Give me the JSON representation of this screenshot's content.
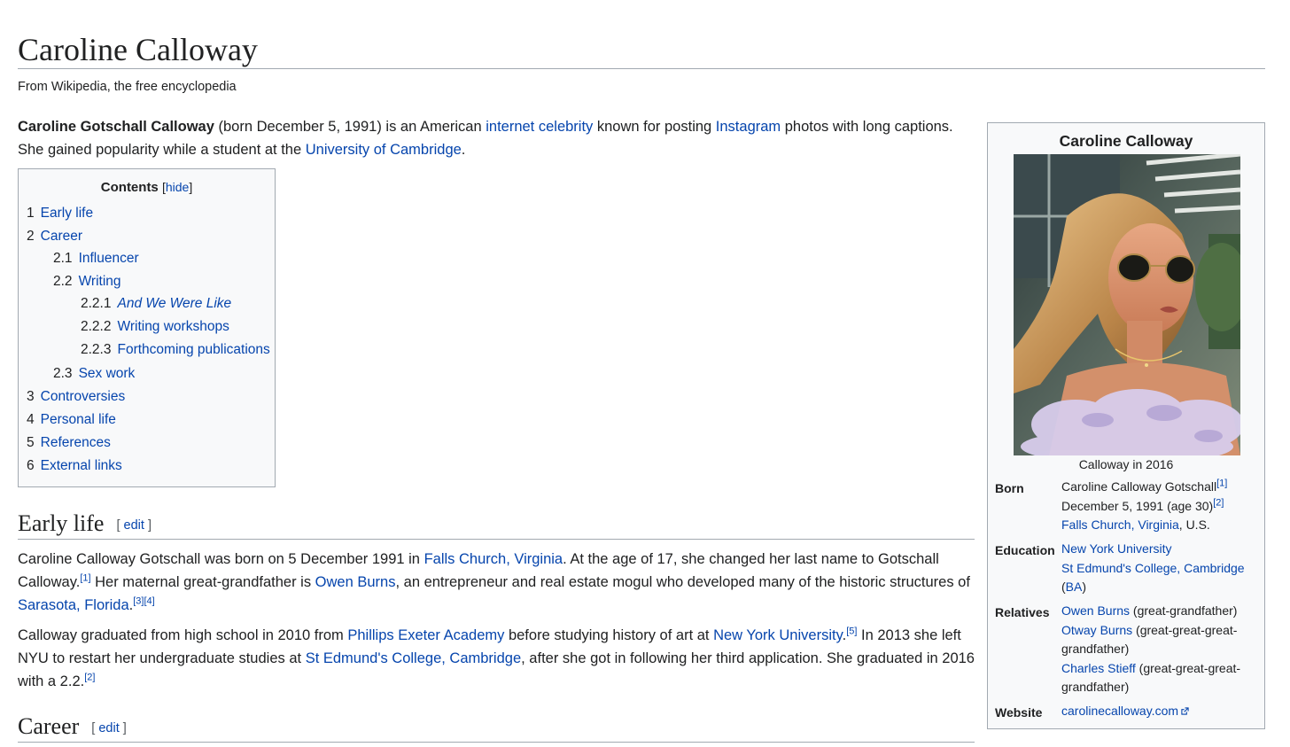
{
  "page": {
    "title": "Caroline Calloway",
    "tagline": "From Wikipedia, the free encyclopedia"
  },
  "lead": {
    "bold_name": "Caroline Gotschall Calloway",
    "t1": " (born December 5, 1991) is an American ",
    "link1": "internet celebrity",
    "t2": " known for posting ",
    "link2": "Instagram",
    "t3": " photos with long captions. She gained popularity while a student at the ",
    "link3": "University of Cambridge",
    "t4": "."
  },
  "toc": {
    "heading": "Contents",
    "bracket_open": "[",
    "hide": "hide",
    "bracket_close": "]",
    "items": [
      {
        "num": "1",
        "label": "Early life"
      },
      {
        "num": "2",
        "label": "Career"
      },
      {
        "num": "2.1",
        "label": "Influencer"
      },
      {
        "num": "2.2",
        "label": "Writing"
      },
      {
        "num": "2.2.1",
        "label": "And We Were Like"
      },
      {
        "num": "2.2.2",
        "label": "Writing workshops"
      },
      {
        "num": "2.2.3",
        "label": "Forthcoming publications"
      },
      {
        "num": "2.3",
        "label": "Sex work"
      },
      {
        "num": "3",
        "label": "Controversies"
      },
      {
        "num": "4",
        "label": "Personal life"
      },
      {
        "num": "5",
        "label": "References"
      },
      {
        "num": "6",
        "label": "External links"
      }
    ]
  },
  "early_life": {
    "heading": "Early life",
    "edit_open": "[",
    "edit": "edit",
    "edit_close": "]",
    "p1": {
      "t1": "Caroline Calloway Gotschall was born on 5 December 1991 in ",
      "link1": "Falls Church, Virginia",
      "t2": ". At the age of 17, she changed her last name to Gotschall Calloway.",
      "ref1": "[1]",
      "t3": " Her maternal great-grandfather is ",
      "link2": "Owen Burns",
      "t4": ", an entrepreneur and real estate mogul who developed many of the historic structures of ",
      "link3": "Sarasota, Florida",
      "t5": ".",
      "ref2": "[3]",
      "ref3": "[4]"
    },
    "p2": {
      "t1": "Calloway graduated from high school in 2010 from ",
      "link1": "Phillips Exeter Academy",
      "t2": " before studying history of art at ",
      "link2": "New York University",
      "t3": ".",
      "ref1": "[5]",
      "t4": " In 2013 she left NYU to restart her undergraduate studies at ",
      "link3": "St Edmund's College, Cambridge",
      "t5": ", after she got in following her third application. She graduated in 2016 with a 2.2.",
      "ref2": "[2]"
    }
  },
  "career": {
    "heading": "Career",
    "edit_open": "[",
    "edit": "edit",
    "edit_close": "]"
  },
  "infobox": {
    "title": "Caroline Calloway",
    "caption": "Calloway in 2016",
    "born_label": "Born",
    "born_name": "Caroline Calloway Gotschall",
    "born_ref1": "[1]",
    "born_date": "December 5, 1991 (age 30)",
    "born_ref2": "[2]",
    "born_place_link": "Falls Church, Virginia",
    "born_place_tail": ", U.S.",
    "education_label": "Education",
    "edu1": "New York University",
    "edu2": "St Edmund's College, Cambridge",
    "edu3_open": "(",
    "edu3_link": "BA",
    "edu3_close": ")",
    "relatives_label": "Relatives",
    "rel1_link": "Owen Burns",
    "rel1_tail": " (great-grandfather)",
    "rel2_link": "Otway Burns",
    "rel2_tail": " (great-great-great-grandfather)",
    "rel3_link": "Charles Stieff",
    "rel3_tail": " (great-great-great-grandfather)",
    "website_label": "Website",
    "website": "carolinecalloway.com",
    "external_icon": "external-link-icon"
  },
  "colors": {
    "link": "#0645ad",
    "text": "#202122",
    "border": "#a2a9b1",
    "box_bg": "#f8f9fa"
  }
}
